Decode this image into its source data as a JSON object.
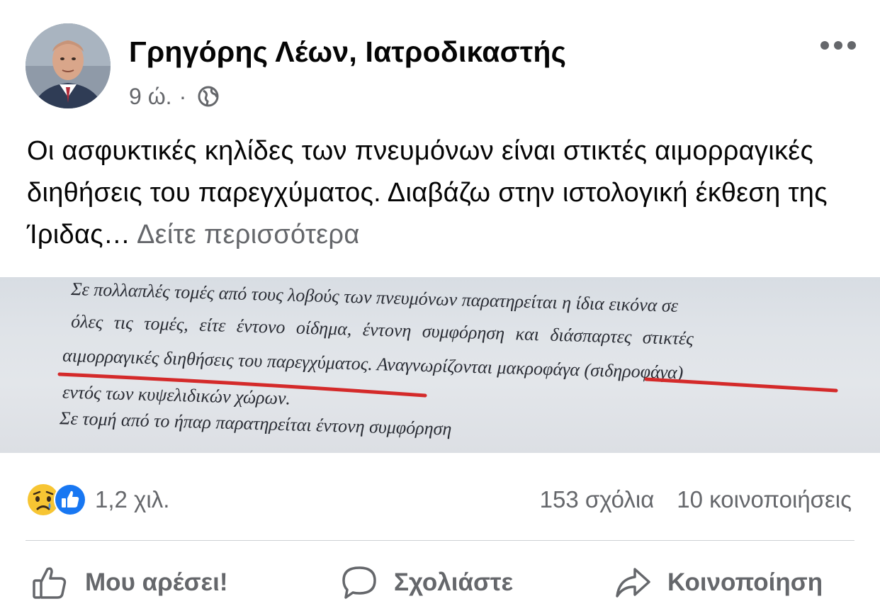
{
  "post": {
    "author": "Γρηγόρης Λέων, Ιατροδικαστής",
    "time": "9 ώ.",
    "separator": "·",
    "privacy_icon": "globe-icon",
    "more_icon": "more-options-icon",
    "text": "Οι ασφυκτικές κηλίδες των πνευμόνων είναι στικτές αιμορραγικές διηθήσεις του παρεγχύματος. Διαβάζω στην ιστολογική έκθεση της Ίριδας…",
    "see_more": "Δείτε περισσότερα"
  },
  "photo": {
    "lines": [
      "Σε πολλαπλές τομές από τους λοβούς των πνευμόνων παρατηρείται η ίδια εικόνα σε",
      "όλες τις τομές, είτε έντονο οίδημα, έντονη συμφόρηση και διάσπαρτες στικτές",
      "αιμορραγικές διηθήσεις του παρεγχύματος. Αναγνωρίζονται μακροφάγα (σιδηροφάγα)",
      "εντός των κυψελιδικών χώρων.",
      "Σε τομή από το ήπαρ παρατηρείται έντονη συμφόρηση"
    ],
    "underline_color": "#d42a2a"
  },
  "engagement": {
    "reaction_icons": [
      "sad-reaction-icon",
      "like-reaction-icon"
    ],
    "reactions_count": "1,2 χιλ.",
    "comments": "153 σχόλια",
    "shares": "10 κοινοποιήσεις"
  },
  "actions": {
    "like": "Μου αρέσει!",
    "comment": "Σχολιάστε",
    "share": "Κοινοποίηση"
  },
  "colors": {
    "text": "#050505",
    "secondary": "#65676b",
    "like_blue": "#1877f2",
    "sad_yellow": "#f7c533"
  }
}
